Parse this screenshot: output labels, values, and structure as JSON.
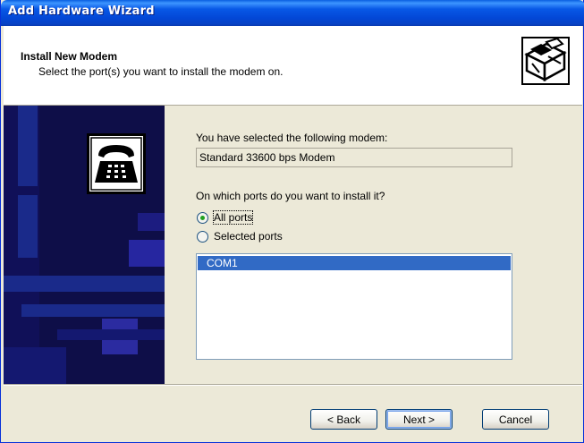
{
  "window": {
    "title": "Add Hardware Wizard"
  },
  "header": {
    "title": "Install New Modem",
    "subtitle": "Select the port(s) you want to install the modem on."
  },
  "content": {
    "selected_label": "You have selected the following modem:",
    "selected_modem": "Standard 33600 bps Modem",
    "question": "On which ports do you want to install it?",
    "options": [
      {
        "label": "All ports",
        "checked": true
      },
      {
        "label": "Selected ports",
        "checked": false
      }
    ],
    "ports": [
      "COM1"
    ]
  },
  "buttons": {
    "back": "< Back",
    "next": "Next >",
    "cancel": "Cancel"
  },
  "icons": {
    "header": "hardware-box-icon",
    "art": "telephone-icon"
  }
}
